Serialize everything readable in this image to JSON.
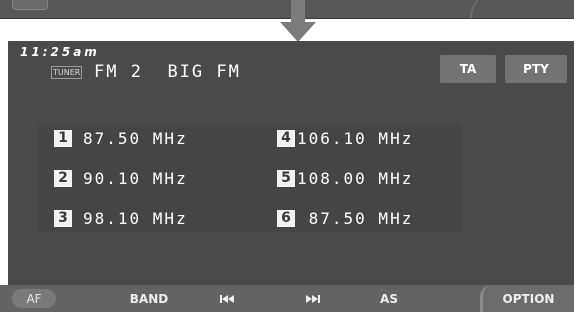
{
  "status": {
    "time": "11:25am"
  },
  "tuner": {
    "source_label": "TUNER",
    "band": "FM 2",
    "station_name": "BIG FM"
  },
  "top_buttons": {
    "ta": "TA",
    "pty": "PTY"
  },
  "presets": [
    {
      "number": "1",
      "frequency": "87.50 MHz"
    },
    {
      "number": "2",
      "frequency": "90.10 MHz"
    },
    {
      "number": "3",
      "frequency": "98.10 MHz"
    },
    {
      "number": "4",
      "frequency": "106.10 MHz"
    },
    {
      "number": "5",
      "frequency": "108.00 MHz"
    },
    {
      "number": "6",
      "frequency": " 87.50 MHz"
    }
  ],
  "bottom_bar": {
    "af": "AF",
    "band": "BAND",
    "prev_icon": "skip-previous-icon",
    "next_icon": "skip-next-icon",
    "as": "AS",
    "option": "OPTION"
  },
  "colors": {
    "screen_bg": "#4a4a4a",
    "button_bg": "#747474",
    "bottom_bar_bg": "#636363",
    "text": "#ffffff"
  }
}
